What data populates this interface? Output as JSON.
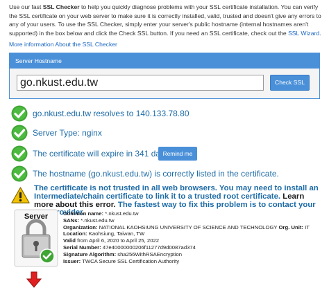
{
  "intro": {
    "p1": "Use our fast ",
    "bold": "SSL Checker",
    "p2": " to help you quickly diagnose problems with your SSL certificate installation. You can verify the SSL certificate on your web server to make sure it is correctly installed, valid, trusted and doesn't give any errors to any of your users. To use the SSL Checker, simply enter your server's public hostname (internal hostnames aren't supported) in the box below and click the Check SSL button. If you need an SSL certificate, check out the ",
    "link": "SSL Wizard",
    "p3": "."
  },
  "more_info": "More information About the SSL Checker",
  "form": {
    "header": "Server Hostname",
    "hostname": "go.nkust.edu.tw",
    "button": "Check SSL"
  },
  "results": {
    "resolves": "go.nkust.edu.tw resolves to 140.133.78.80",
    "server_type": "Server Type: nginx",
    "expiry": "The certificate will expire in 341 days.",
    "remind": "Remind me",
    "hostname_listed": "The hostname (go.nkust.edu.tw) is correctly listed in the certificate."
  },
  "warning": {
    "t1": "The certificate is not trusted in all web browsers. You may need to install an Intermediate/chain certificate to link it to a trusted root certificate.",
    "t2": " Learn more about this error.",
    "t3": " The fastest way to fix this problem is to contact your SSL provider."
  },
  "cert": {
    "badge": "Server",
    "common_name_k": "Common name:",
    "common_name_v": " *.nkust.edu.tw",
    "sans_k": "SANs:",
    "sans_v": " *.nkust.edu.tw",
    "org_k": "Organization:",
    "org_v": " NATIONAL KAOHSIUNG UNIVERSITY OF SCIENCE AND TECHNOLOGY ",
    "org_unit_k": "Org. Unit:",
    "org_unit_v": " IT",
    "location_k": "Location:",
    "location_v": " Kaohsiung, Taiwan, TW",
    "valid_k": "Valid",
    "valid_v": " from April 6, 2020 to April 25, 2022",
    "serial_k": "Serial Number:",
    "serial_v": " 47e40000000206f11277d9d0087ad374",
    "sig_k": "Signature Algorithm:",
    "sig_v": " sha256WithRSAEncryption",
    "issuer_k": "Issuer:",
    "issuer_v": " TWCA Secure SSL Certification Authority"
  },
  "colors": {
    "accent": "#4a90d9",
    "link": "#1a66c2",
    "result_text": "#1d6ba6",
    "check_green": "#3fa535",
    "warning_yellow": "#f2c200",
    "arrow_red": "#e02020"
  },
  "icons": [
    "check-icon",
    "warning-icon",
    "server-lock-icon",
    "down-arrow-icon"
  ]
}
